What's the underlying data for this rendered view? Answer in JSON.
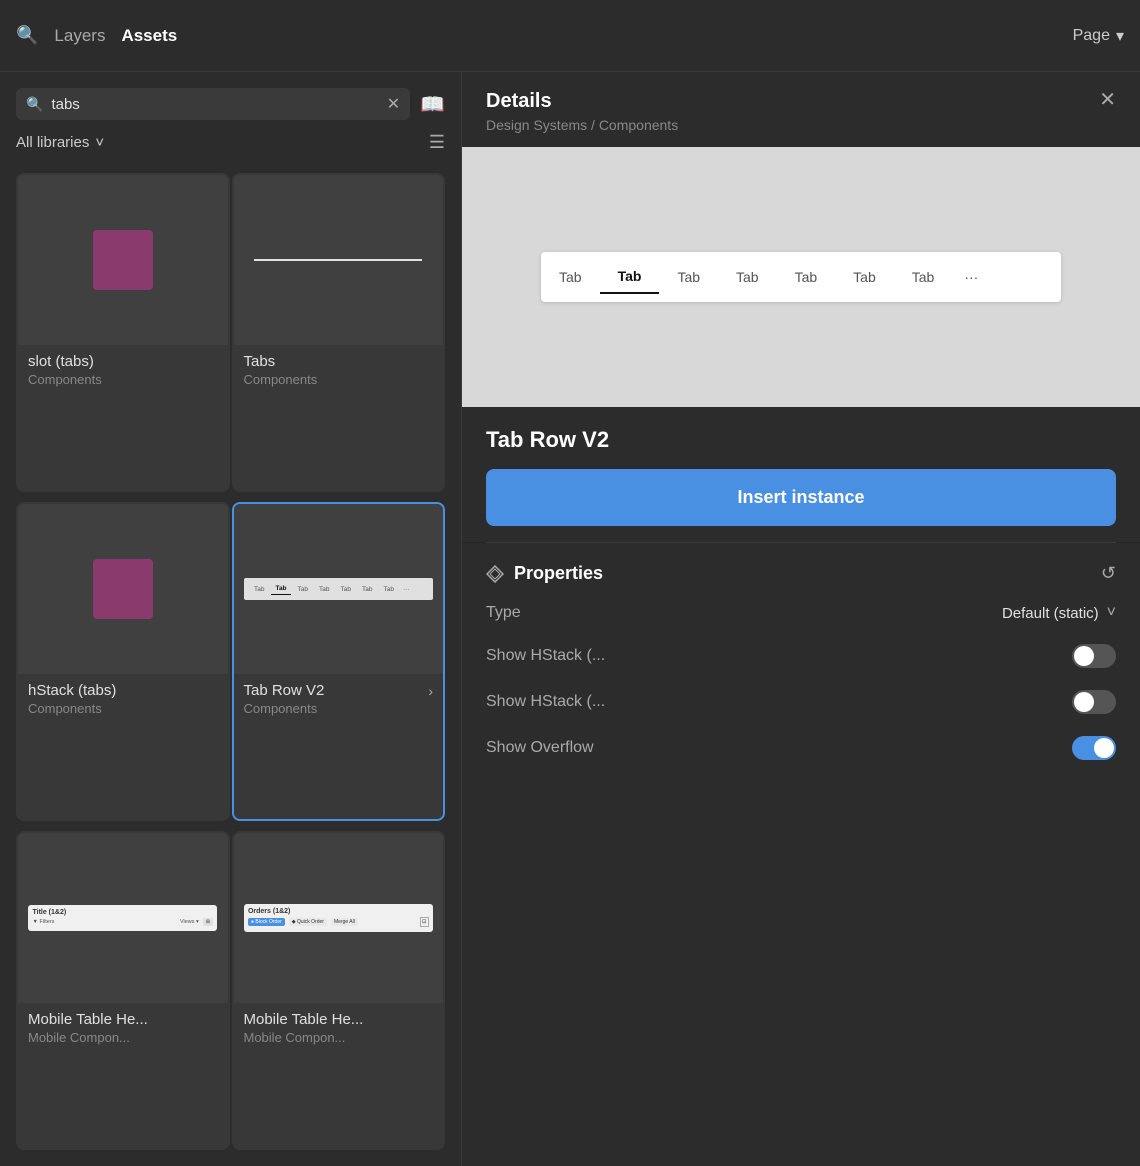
{
  "topbar": {
    "search_icon": "🔍",
    "layers_label": "Layers",
    "assets_label": "Assets",
    "page_label": "Page",
    "chevron_icon": "▾"
  },
  "left_panel": {
    "search_placeholder": "tabs",
    "clear_icon": "✕",
    "bookmark_icon": "📖",
    "libraries_label": "All libraries",
    "chevron_icon": "˅",
    "list_view_icon": "≡",
    "components": [
      {
        "id": "slot-tabs",
        "name": "slot (tabs)",
        "library": "Components",
        "thumb_type": "purple-rect",
        "selected": false,
        "has_arrow": false
      },
      {
        "id": "tabs",
        "name": "Tabs",
        "library": "Components",
        "thumb_type": "tabs-line",
        "selected": false,
        "has_arrow": false
      },
      {
        "id": "hstack-tabs",
        "name": "hStack (tabs)",
        "library": "Components",
        "thumb_type": "purple-rect",
        "selected": false,
        "has_arrow": false
      },
      {
        "id": "tab-row-v2",
        "name": "Tab Row V2",
        "library": "Components",
        "thumb_type": "tabrow",
        "selected": true,
        "has_arrow": true
      },
      {
        "id": "mobile-table-1",
        "name": "Mobile Table He...",
        "library": "Mobile Compon...",
        "thumb_type": "mobile-1",
        "selected": false,
        "has_arrow": false
      },
      {
        "id": "mobile-table-2",
        "name": "Mobile Table He...",
        "library": "Mobile Compon...",
        "thumb_type": "mobile-2",
        "selected": false,
        "has_arrow": false
      }
    ]
  },
  "right_panel": {
    "header": {
      "title": "Details",
      "breadcrumb": "Design Systems / Components",
      "close_icon": "✕"
    },
    "preview": {
      "tabs": [
        "Tab",
        "Tab",
        "Tab",
        "Tab",
        "Tab",
        "Tab",
        "Tab"
      ],
      "active_index": 1,
      "more_label": "···"
    },
    "component_title": "Tab Row V2",
    "insert_button_label": "Insert instance",
    "properties": {
      "title": "Properties",
      "reset_icon": "↺",
      "rows": [
        {
          "id": "type",
          "label": "Type",
          "control_type": "dropdown",
          "value": "Default (static)"
        },
        {
          "id": "show-hstack-1",
          "label": "Show HStack (...",
          "control_type": "toggle",
          "value": false
        },
        {
          "id": "show-hstack-2",
          "label": "Show HStack (...",
          "control_type": "toggle",
          "value": false
        },
        {
          "id": "show-overflow",
          "label": "Show Overflow",
          "control_type": "toggle",
          "value": true
        }
      ]
    }
  },
  "colors": {
    "accent_blue": "#4a90e2",
    "purple": "#8b3a6e",
    "bg_dark": "#2c2c2c",
    "bg_darker": "#252525",
    "border": "#3a3a3a",
    "text_primary": "#ffffff",
    "text_secondary": "#aaaaaa"
  }
}
